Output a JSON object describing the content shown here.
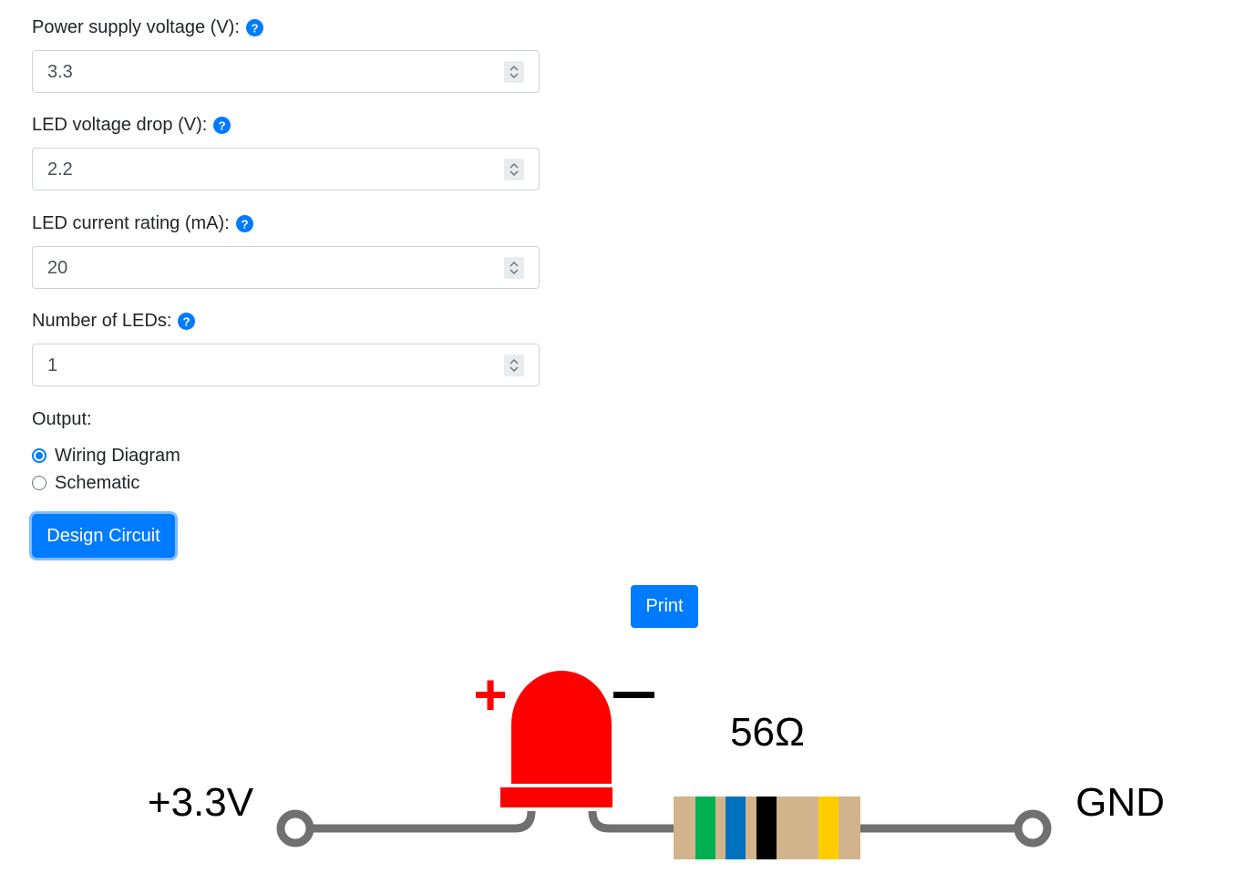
{
  "form": {
    "fields": [
      {
        "label": "Power supply voltage (V):",
        "value": "3.3"
      },
      {
        "label": "LED voltage drop (V):",
        "value": "2.2"
      },
      {
        "label": "LED current rating (mA):",
        "value": "20"
      },
      {
        "label": "Number of LEDs:",
        "value": "1"
      }
    ],
    "help_icon": "question-circle-icon",
    "spinner_icon": "up-down-chevron-icon",
    "output": {
      "label": "Output:",
      "options": [
        {
          "label": "Wiring Diagram",
          "checked": true
        },
        {
          "label": "Schematic",
          "checked": false
        }
      ]
    },
    "design_button": "Design Circuit"
  },
  "print_button": "Print",
  "diagram": {
    "supply_label": "+3.3V",
    "ground_label": "GND",
    "resistor_label": "56Ω",
    "led_plus": "+",
    "led_minus": "−",
    "led_color": "#ff0000",
    "resistor_body_color": "#d2b48c",
    "resistor_bands": [
      "#00b050",
      "#0070c0",
      "#000000",
      "#ffcc00"
    ],
    "wire_color": "#707070"
  },
  "colors": {
    "accent": "#007bff"
  }
}
